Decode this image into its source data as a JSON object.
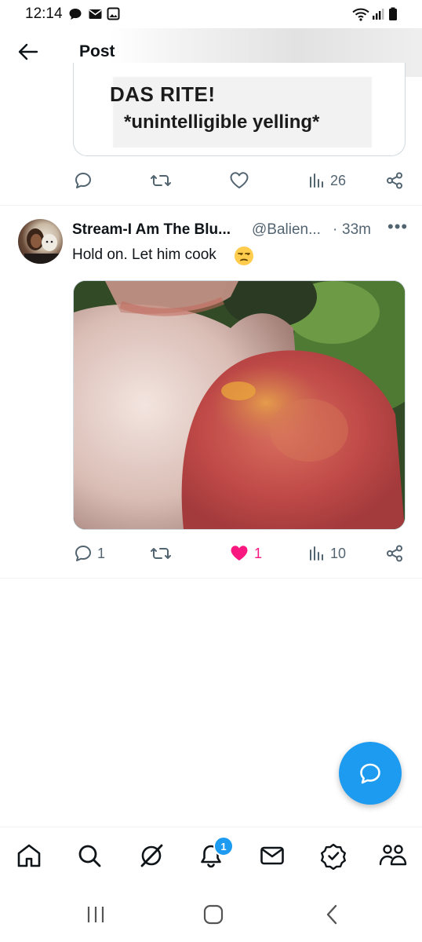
{
  "status_bar": {
    "time": "12:14",
    "icons": [
      "chat-bubble-icon",
      "mail-icon",
      "image-icon",
      "wifi-icon",
      "signal-icon",
      "battery-icon"
    ]
  },
  "header": {
    "title": "Post",
    "back_icon": "arrow-left-icon"
  },
  "quoted_card": {
    "line1": "DAS RITE!",
    "line2": "*unintelligible yelling*"
  },
  "top_actions": {
    "reply_count": "",
    "retweet_count": "",
    "like_count": "",
    "views": "26"
  },
  "post": {
    "author": "Stream-I Am The Blu...",
    "handle": "@Balien...",
    "separator": "·",
    "time": "33m",
    "more": "•••",
    "text": "Hold on. Let him cook",
    "emoji": "unamused-face",
    "image_alt_hint": "sunburned shoulder with blisters",
    "actions": {
      "reply_count": "1",
      "retweet_count": "",
      "like_count": "1",
      "views": "10",
      "liked": true
    }
  },
  "bottom_nav": {
    "items": [
      "home-icon",
      "search-icon",
      "grok-icon",
      "notifications-icon",
      "messages-icon",
      "verified-icon",
      "communities-icon"
    ],
    "notification_badge": "1"
  },
  "colors": {
    "accent": "#1d9bf0",
    "like": "#f91880",
    "muted": "#536471",
    "text": "#0f1419"
  }
}
